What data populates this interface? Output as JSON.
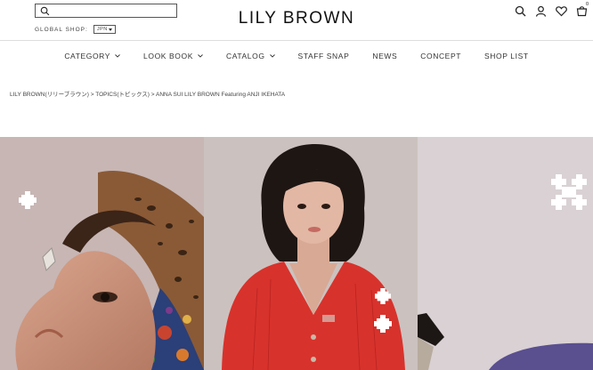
{
  "search": {
    "placeholder": ""
  },
  "global_shop": {
    "label": "GLOBAL SHOP:",
    "language": "JPN"
  },
  "logo": {
    "text": "LILY BROWN"
  },
  "header_icons": [
    "search-icon",
    "user-icon",
    "heart-icon",
    "cart-icon"
  ],
  "cart": {
    "count": "0"
  },
  "nav": {
    "items": [
      {
        "label": "CATEGORY",
        "has_dropdown": true
      },
      {
        "label": "LOOK BOOK",
        "has_dropdown": true
      },
      {
        "label": "CATALOG",
        "has_dropdown": true
      },
      {
        "label": "STAFF SNAP",
        "has_dropdown": false
      },
      {
        "label": "NEWS",
        "has_dropdown": false
      },
      {
        "label": "CONCEPT",
        "has_dropdown": false
      },
      {
        "label": "SHOP LIST",
        "has_dropdown": false
      }
    ]
  },
  "breadcrumb": {
    "items": [
      "LILY BROWN(リリーブラウン)",
      "TOPICS(トピックス)",
      "ANNA SUI LILY BROWN Featuring ANJI IKEHATA"
    ],
    "separator": ">"
  },
  "colors": {
    "text": "#222222",
    "border": "#dddddd",
    "cardigan_red": "#d8322c",
    "background_pink": "#c9c0bd"
  }
}
